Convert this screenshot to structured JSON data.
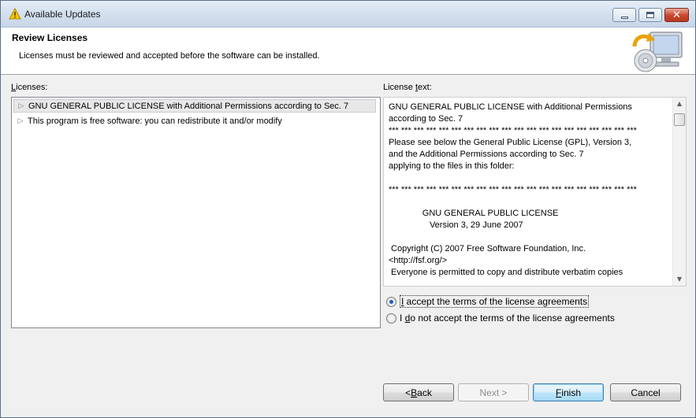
{
  "window": {
    "title": "Available Updates"
  },
  "banner": {
    "title": "Review Licenses",
    "description": "Licenses must be reviewed and accepted before the software can be installed."
  },
  "licenses": {
    "label_first": "L",
    "label_rest": "icenses:",
    "items": [
      {
        "label": "GNU GENERAL PUBLIC LICENSE with Additional Permissions according to Sec. 7",
        "selected": true
      },
      {
        "label": "This program is free software: you can redistribute it and/or modify",
        "selected": false
      }
    ]
  },
  "license_text": {
    "label_pre": "License ",
    "label_u": "t",
    "label_post": "ext:",
    "lines": [
      "GNU GENERAL PUBLIC LICENSE with Additional Permissions",
      "according to Sec. 7",
      "*** *** *** *** *** *** *** *** *** *** *** *** *** *** *** *** *** *** *** ***",
      "Please see below the General Public License (GPL), Version 3,",
      "and the Additional Permissions according to Sec. 7",
      "applying to the files in this folder:",
      "",
      "*** *** *** *** *** *** *** *** *** *** *** *** *** *** *** *** *** *** *** ***",
      "",
      "              GNU GENERAL PUBLIC LICENSE",
      "                 Version 3, 29 June 2007",
      "",
      " Copyright (C) 2007 Free Software Foundation, Inc.",
      "<http://fsf.org/>",
      " Everyone is permitted to copy and distribute verbatim copies"
    ]
  },
  "radios": {
    "accept": {
      "u": "I",
      "rest": " accept the terms of the license agreements",
      "checked": true
    },
    "decline": {
      "pre": "I ",
      "u": "d",
      "rest": "o not accept the terms of the license agreements",
      "checked": false
    }
  },
  "buttons": {
    "back": {
      "pre": "< ",
      "u": "B",
      "rest": "ack"
    },
    "next": {
      "label": "Next >"
    },
    "finish": {
      "u": "F",
      "rest": "inish"
    },
    "cancel": {
      "label": "Cancel"
    }
  },
  "colors": {
    "accent": "#1b5fb7",
    "default_button_border": "#3c7fb1"
  }
}
